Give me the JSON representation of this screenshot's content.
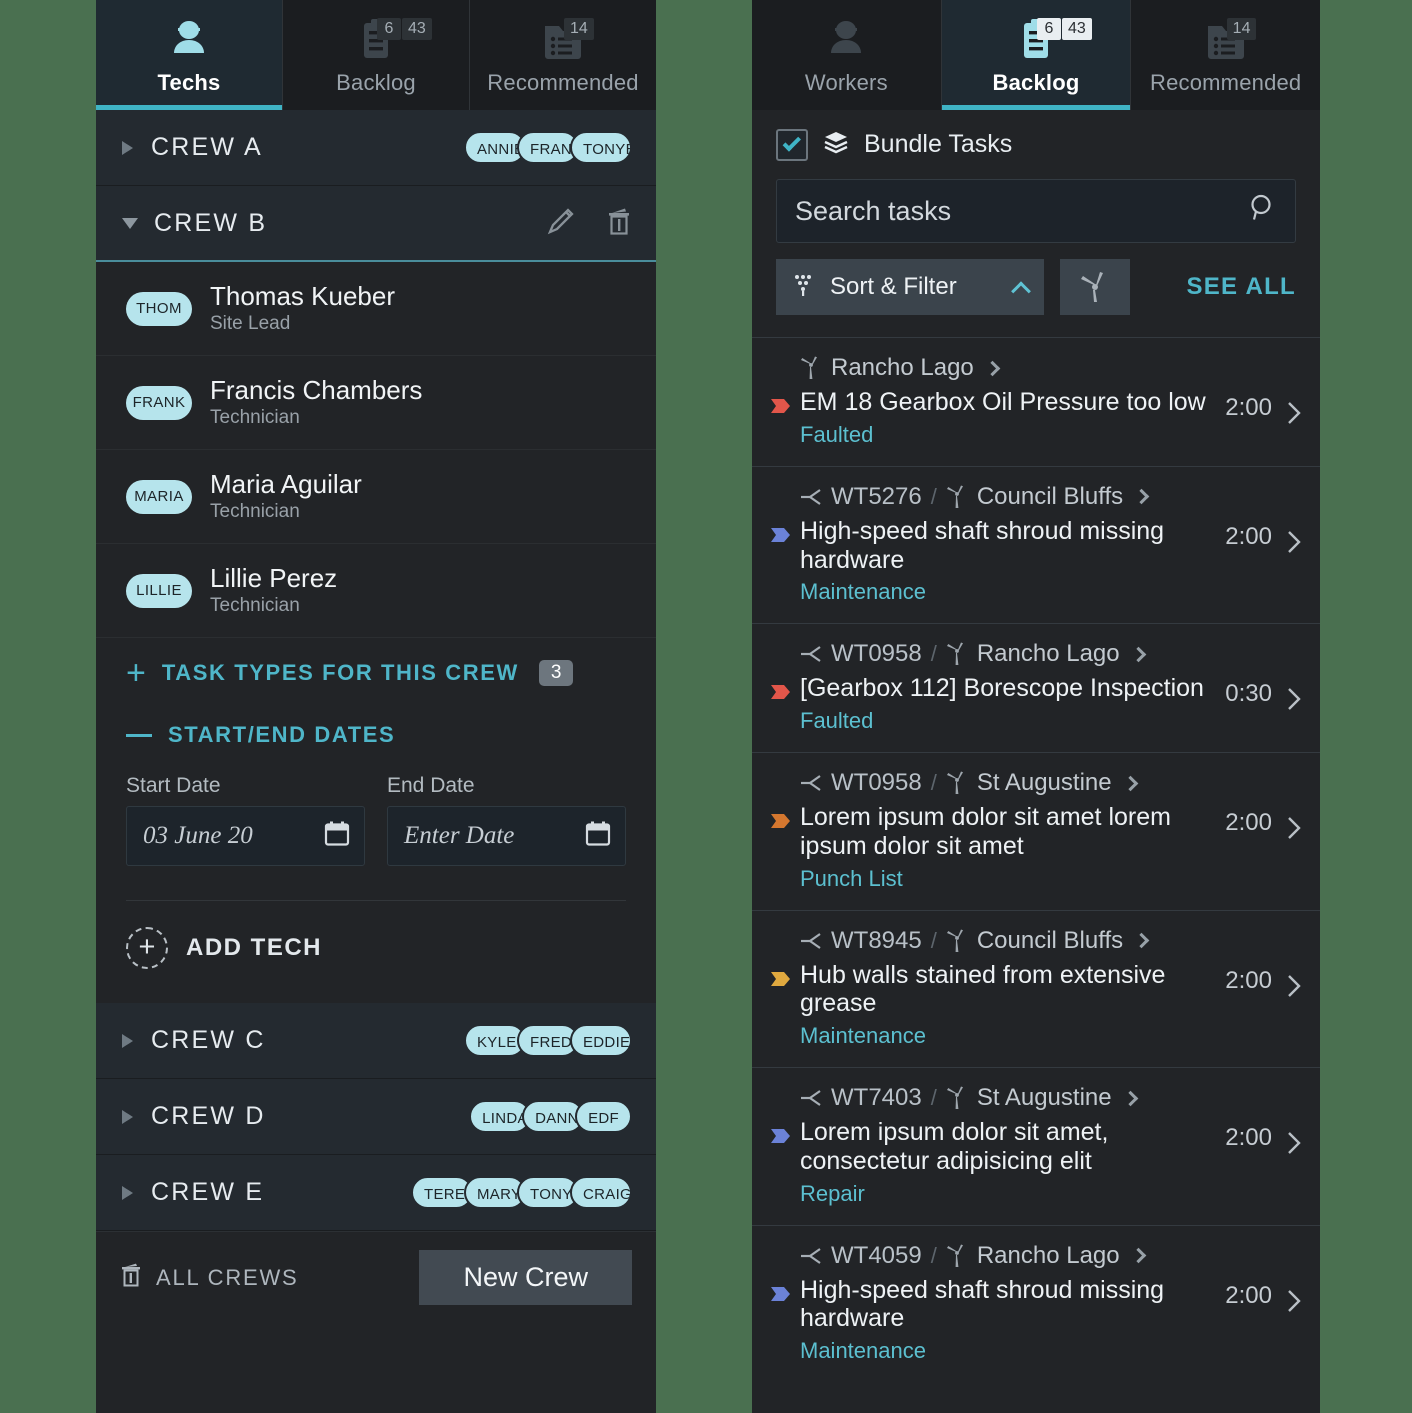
{
  "techs_panel": {
    "tabs": [
      {
        "label": "Techs",
        "icon": "technician-icon",
        "active": true,
        "badges": []
      },
      {
        "label": "Backlog",
        "icon": "clipboard-icon",
        "active": false,
        "badges": [
          "6",
          "43"
        ]
      },
      {
        "label": "Recommended",
        "icon": "task-list-icon",
        "active": false,
        "badges": [
          "14"
        ]
      }
    ],
    "crews": [
      {
        "name": "CREW A",
        "expanded": false,
        "members": [
          "ANNIEP",
          "FRANKC",
          "TONYB"
        ]
      },
      {
        "name": "CREW B",
        "expanded": true,
        "members": []
      },
      {
        "name": "CREW C",
        "expanded": false,
        "members": [
          "KYLE G",
          "FREDSM",
          "EDDIE"
        ]
      },
      {
        "name": "CREW D",
        "expanded": false,
        "members": [
          "LINDAC",
          "DANNIE",
          "EDF"
        ]
      },
      {
        "name": "CREW E",
        "expanded": false,
        "members": [
          "TERESA",
          "MARYHI",
          "TONYC",
          "CRAIG"
        ]
      }
    ],
    "crew_b_detail": {
      "techs": [
        {
          "initials": "THOM",
          "name": "Thomas Kueber",
          "role": "Site Lead"
        },
        {
          "initials": "FRANK",
          "name": "Francis Chambers",
          "role": "Technician"
        },
        {
          "initials": "MARIA",
          "name": "Maria Aguilar",
          "role": "Technician"
        },
        {
          "initials": "LILLIE",
          "name": "Lillie Perez",
          "role": "Technician"
        }
      ],
      "task_types_label": "TASK TYPES FOR THIS CREW",
      "task_types_count": "3",
      "dates_label": "START/END DATES",
      "start_date_label": "Start Date",
      "start_date_value": "03 June 20",
      "end_date_label": "End Date",
      "end_date_placeholder": "Enter Date",
      "add_tech_label": "ADD TECH"
    },
    "footer": {
      "all_crews_label": "ALL CREWS",
      "new_crew_label": "New Crew"
    }
  },
  "backlog_panel": {
    "tabs": [
      {
        "label": "Workers",
        "icon": "worker-icon",
        "active": false,
        "badges": []
      },
      {
        "label": "Backlog",
        "icon": "clipboard-icon",
        "active": true,
        "badges": [
          "6",
          "43"
        ]
      },
      {
        "label": "Recommended",
        "icon": "task-list-icon",
        "active": false,
        "badges": [
          "14"
        ]
      }
    ],
    "controls": {
      "bundle_tasks_label": "Bundle Tasks",
      "bundle_tasks_checked": true,
      "search_placeholder": "Search tasks",
      "search_value": "",
      "sort_filter_label": "Sort & Filter",
      "see_all_label": "SEE ALL"
    },
    "tasks": [
      {
        "wt_id": "",
        "site": "Rancho Lago",
        "title": "EM 18 Gearbox Oil Pressure too low",
        "category": "Faulted",
        "duration": "2:00",
        "priority_color": "#e2564a"
      },
      {
        "wt_id": "WT5276",
        "site": "Council Bluffs",
        "title": "High-speed shaft shroud missing hardware",
        "category": "Maintenance",
        "duration": "2:00",
        "priority_color": "#6b82d8"
      },
      {
        "wt_id": "WT0958",
        "site": "Rancho Lago",
        "title": "[Gearbox 112] Borescope Inspection",
        "category": "Faulted",
        "duration": "0:30",
        "priority_color": "#e2564a"
      },
      {
        "wt_id": "WT0958",
        "site": "St Augustine",
        "title": "Lorem ipsum dolor sit amet lorem ipsum dolor sit amet",
        "category": "Punch List",
        "duration": "2:00",
        "priority_color": "#d4772f"
      },
      {
        "wt_id": "WT8945",
        "site": "Council Bluffs",
        "title": "Hub walls stained from extensive grease",
        "category": "Maintenance",
        "duration": "2:00",
        "priority_color": "#e0a93f"
      },
      {
        "wt_id": "WT7403",
        "site": "St Augustine",
        "title": "Lorem ipsum dolor sit amet, consectetur adipisicing elit",
        "category": "Repair",
        "duration": "2:00",
        "priority_color": "#6b82d8"
      },
      {
        "wt_id": "WT4059",
        "site": "Rancho Lago",
        "title": "High-speed shaft shroud missing hardware",
        "category": "Maintenance",
        "duration": "2:00",
        "priority_color": "#6b82d8"
      }
    ]
  },
  "colors": {
    "accent": "#3fb4c6",
    "link": "#4fb6c9",
    "panel_bg": "#222427",
    "page_bg": "#4a7050",
    "chip_bg": "#b6e4ec"
  }
}
